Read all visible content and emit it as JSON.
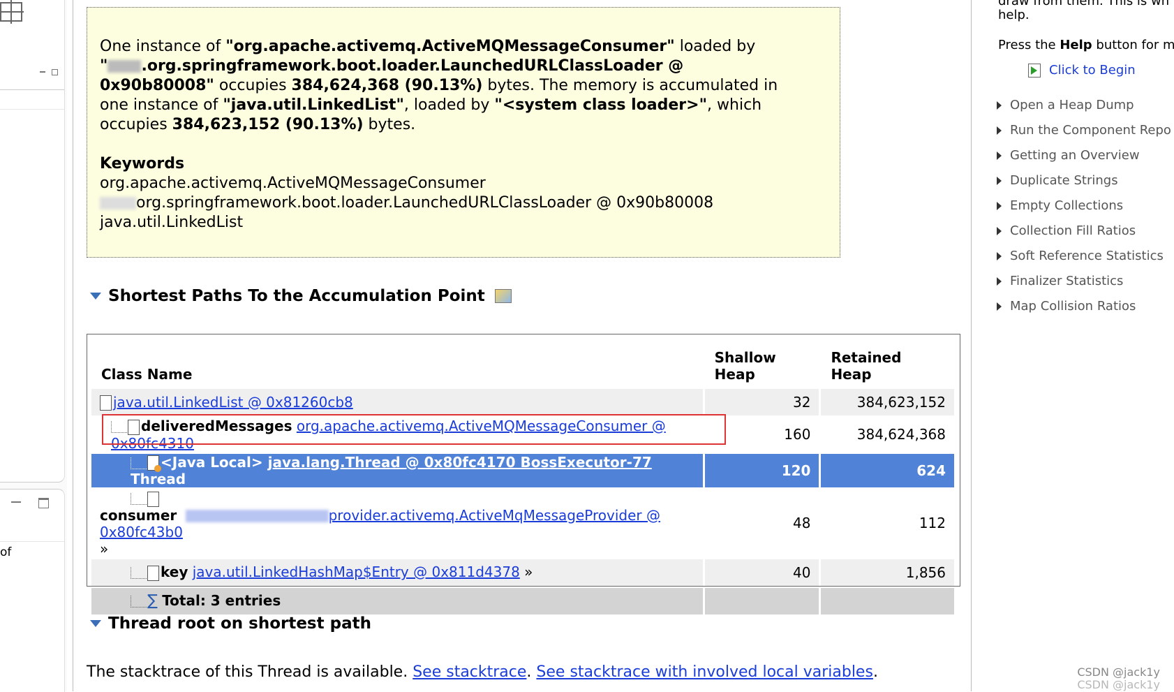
{
  "left_panel": {
    "bottom_text": "of"
  },
  "summary": {
    "p1_a": "One instance of ",
    "consumer_class": "\"org.apache.activemq.ActiveMQMessageConsumer\"",
    "p1_b": " loaded by",
    "loader_quote_start": "\"",
    "loader_rest": ".org.springframework.boot.loader.LaunchedURLClassLoader @",
    "loader_addr": "0x90b80008\"",
    "p1_c": " occupies ",
    "size1": "384,624,368 (90.13%)",
    "p1_d": " bytes. The memory is accumulated in",
    "p1_e": "one instance of ",
    "linked_class": "\"java.util.LinkedList\"",
    "p1_f": ", loaded by ",
    "system_loader": "\"<system class loader>\"",
    "p1_g": ", which",
    "p1_h": "occupies ",
    "size2": "384,623,152 (90.13%)",
    "p1_i": " bytes.",
    "keywords_title": "Keywords",
    "kw1": "org.apache.activemq.ActiveMQMessageConsumer",
    "kw2": "org.springframework.boot.loader.LaunchedURLClassLoader @ 0x90b80008",
    "kw3": "java.util.LinkedList"
  },
  "paths_section": {
    "title": "Shortest Paths To the Accumulation Point",
    "icon": "image-icon"
  },
  "table": {
    "headers": {
      "class_name": "Class Name",
      "shallow_line1": "Shallow",
      "shallow_line2": "Heap",
      "retained_line1": "Retained",
      "retained_line2": "Heap"
    },
    "rows": [
      {
        "field": "",
        "link": "java.util.LinkedList @ 0x81260cb8",
        "suffix": "",
        "shallow": "32",
        "retained": "384,623,152"
      },
      {
        "field": "deliveredMessages",
        "link": "org.apache.activemq.ActiveMQMessageConsumer @ 0x80fc4310",
        "suffix": "",
        "shallow": "160",
        "retained": "384,624,368"
      },
      {
        "field": "<Java Local>",
        "link": "java.lang.Thread @ 0x80fc4170 BossExecutor-77",
        "suffix": "Thread",
        "shallow": "120",
        "retained": "624"
      },
      {
        "field": "consumer",
        "link": "provider.activemq.ActiveMqMessageProvider @ 0x80fc43b0",
        "suffix": "»",
        "shallow": "48",
        "retained": "112"
      },
      {
        "field": "key",
        "link": "java.util.LinkedHashMap$Entry @ 0x811d4378",
        "suffix": "»",
        "shallow": "40",
        "retained": "1,856"
      }
    ],
    "total": "Total: 3 entries"
  },
  "thread_section": {
    "title": "Thread root on shortest path",
    "text": "The stacktrace of this Thread is available. ",
    "link1": "See stacktrace",
    "sep": ". ",
    "link2": "See stacktrace with involved local variables",
    "end": "."
  },
  "right_panel": {
    "top_text": "draw from them. This is wh",
    "top_text2": "help.",
    "press_a": "Press the ",
    "press_help": "Help",
    "press_b": " button for m",
    "click_to_begin": "Click to Begin",
    "items": [
      "Open a Heap Dump",
      "Run the Component Repo",
      "Getting an Overview",
      "Duplicate Strings",
      "Empty Collections",
      "Collection Fill Ratios",
      "Soft Reference Statistics",
      "Finalizer Statistics",
      "Map Collision Ratios"
    ]
  },
  "watermark": {
    "line1": "CSDN @jack1y",
    "line2": "CSDN @jack1y"
  },
  "colors": {
    "selection": "#5083d8",
    "highlight_border": "#dd3333",
    "summary_bg": "#fdfde0",
    "link": "#1a3cd9"
  }
}
